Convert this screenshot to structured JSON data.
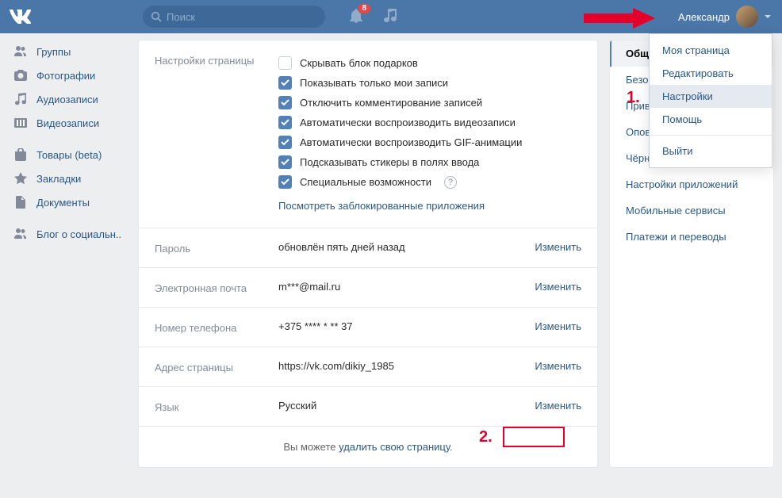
{
  "header": {
    "search_placeholder": "Поиск",
    "notification_count": "8",
    "username": "Александр"
  },
  "sidebar": {
    "items": [
      {
        "icon": "users",
        "label": "Группы"
      },
      {
        "icon": "camera",
        "label": "Фотографии"
      },
      {
        "icon": "music",
        "label": "Аудиозаписи"
      },
      {
        "icon": "video",
        "label": "Видеозаписи"
      }
    ],
    "items2": [
      {
        "icon": "bag",
        "label": "Товары (beta)"
      },
      {
        "icon": "star",
        "label": "Закладки"
      },
      {
        "icon": "doc",
        "label": "Документы"
      }
    ],
    "items3": [
      {
        "icon": "users",
        "label": "Блог о социальн.."
      }
    ]
  },
  "page_settings": {
    "label": "Настройки страницы",
    "checks": [
      {
        "checked": false,
        "label": "Скрывать блок подарков"
      },
      {
        "checked": true,
        "label": "Показывать только мои записи"
      },
      {
        "checked": true,
        "label": "Отключить комментирование записей"
      },
      {
        "checked": true,
        "label": "Автоматически воспроизводить видеозаписи"
      },
      {
        "checked": true,
        "label": "Автоматически воспроизводить GIF-анимации"
      },
      {
        "checked": true,
        "label": "Подсказывать стикеры в полях ввода"
      },
      {
        "checked": true,
        "label": "Специальные возможности",
        "help": true
      }
    ],
    "blocked_apps_link": "Посмотреть заблокированные приложения"
  },
  "rows": [
    {
      "label": "Пароль",
      "value": "обновлён пять дней назад",
      "action": "Изменить"
    },
    {
      "label": "Электронная почта",
      "value": "m***@mail.ru",
      "action": "Изменить"
    },
    {
      "label": "Номер телефона",
      "value": "+375 **** * ** 37",
      "action": "Изменить"
    },
    {
      "label": "Адрес страницы",
      "value": "https://vk.com/dikiy_1985",
      "action": "Изменить"
    },
    {
      "label": "Язык",
      "value": "Русский",
      "action": "Изменить"
    }
  ],
  "footer": {
    "prefix": "Вы можете ",
    "link": "удалить свою страницу",
    "suffix": "."
  },
  "settings_nav": [
    "Общее",
    "Безопасность",
    "Приватность",
    "Оповещения",
    "Чёрный список",
    "Настройки приложений",
    "Мобильные сервисы",
    "Платежи и переводы"
  ],
  "dropdown": [
    "Моя страница",
    "Редактировать",
    "Настройки",
    "Помощь",
    "--",
    "Выйти"
  ],
  "annotations": {
    "one": "1.",
    "two": "2."
  }
}
